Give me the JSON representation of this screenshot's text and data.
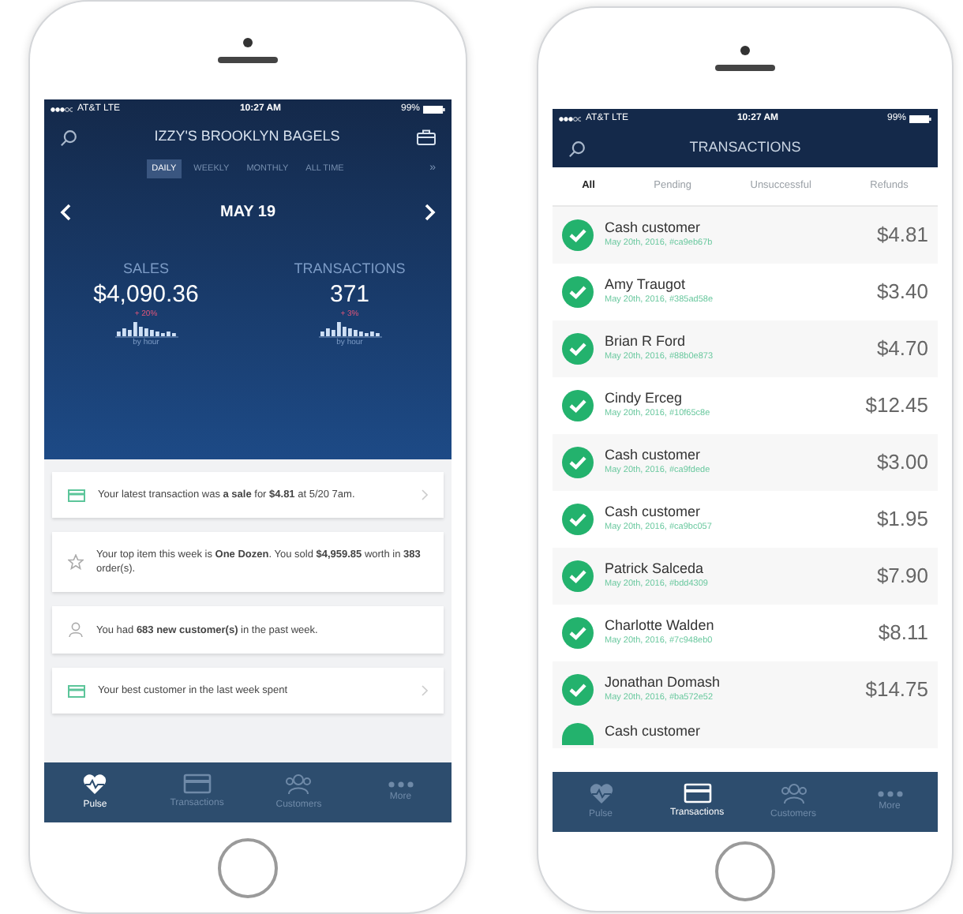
{
  "pulse_screen": {
    "status_bar": {
      "carrier": "AT&T LTE",
      "time": "10:27 AM",
      "battery": "99%"
    },
    "title": "IZZY'S BROOKLYN BAGELS",
    "periods": [
      {
        "label": "DAILY",
        "selected": true
      },
      {
        "label": "WEEKLY",
        "selected": false
      },
      {
        "label": "MONTHLY",
        "selected": false
      },
      {
        "label": "ALL TIME",
        "selected": false
      }
    ],
    "more_periods": "»",
    "date": "MAY 19",
    "stats": [
      {
        "label": "SALES",
        "value": "$4,090.36",
        "change": "+ 20%",
        "caption": "by hour"
      },
      {
        "label": "TRANSACTIONS",
        "value": "371",
        "change": "+ 3%",
        "caption": "by hour"
      }
    ],
    "cards": [
      {
        "kind": "card",
        "text": "Your latest transaction was **a sale** for **$4.81** at 5/20 7am.",
        "chevron": true
      },
      {
        "kind": "star",
        "text": "Your top item this week is **One Dozen**. You sold **$4,959.85** worth in **383** order(s).",
        "chevron": false
      },
      {
        "kind": "person",
        "text": "You had **683 new customer(s)** in the past week.",
        "chevron": false
      },
      {
        "kind": "card",
        "text": "Your best customer in the last week spent",
        "chevron": true
      }
    ],
    "tabs": [
      {
        "kind": "pulse",
        "label": "Pulse",
        "selected": true
      },
      {
        "kind": "card",
        "label": "Transactions",
        "selected": false
      },
      {
        "kind": "people",
        "label": "Customers",
        "selected": false
      },
      {
        "kind": "more",
        "label": "More",
        "selected": false
      }
    ]
  },
  "transactions_screen": {
    "status_bar": {
      "carrier": "AT&T LTE",
      "time": "10:27 AM",
      "battery": "99%"
    },
    "title": "TRANSACTIONS",
    "filters": [
      {
        "label": "All",
        "selected": true
      },
      {
        "label": "Pending",
        "selected": false
      },
      {
        "label": "Unsuccessful",
        "selected": false
      },
      {
        "label": "Refunds",
        "selected": false
      }
    ],
    "rows": [
      {
        "completed": true,
        "name": "Cash customer",
        "detail": "May 20th, 2016, #ca9eb67b",
        "amount": "$4.81"
      },
      {
        "completed": true,
        "name": "Amy Traugot",
        "detail": "May 20th, 2016, #385ad58e",
        "amount": "$3.40"
      },
      {
        "completed": true,
        "name": "Brian R Ford",
        "detail": "May 20th, 2016, #88b0e873",
        "amount": "$4.70"
      },
      {
        "completed": true,
        "name": "Cindy Erceg",
        "detail": "May 20th, 2016, #10f65c8e",
        "amount": "$12.45"
      },
      {
        "completed": true,
        "name": "Cash customer",
        "detail": "May 20th, 2016, #ca9fdede",
        "amount": "$3.00"
      },
      {
        "completed": true,
        "name": "Cash customer",
        "detail": "May 20th, 2016, #ca9bc057",
        "amount": "$1.95"
      },
      {
        "completed": true,
        "name": "Patrick Salceda",
        "detail": "May 20th, 2016, #bdd4309",
        "amount": "$7.90"
      },
      {
        "completed": true,
        "name": "Charlotte Walden",
        "detail": "May 20th, 2016, #7c948eb0",
        "amount": "$8.11"
      },
      {
        "completed": true,
        "name": "Jonathan Domash",
        "detail": "May 20th, 2016, #ba572e52",
        "amount": "$14.75"
      }
    ],
    "partial_row": {
      "completed": true,
      "name": "Cash customer"
    },
    "tabs": [
      {
        "kind": "pulse",
        "label": "Pulse",
        "selected": false
      },
      {
        "kind": "card",
        "label": "Transactions",
        "selected": true
      },
      {
        "kind": "people",
        "label": "Customers",
        "selected": false
      },
      {
        "kind": "more",
        "label": "More",
        "selected": false
      }
    ]
  }
}
